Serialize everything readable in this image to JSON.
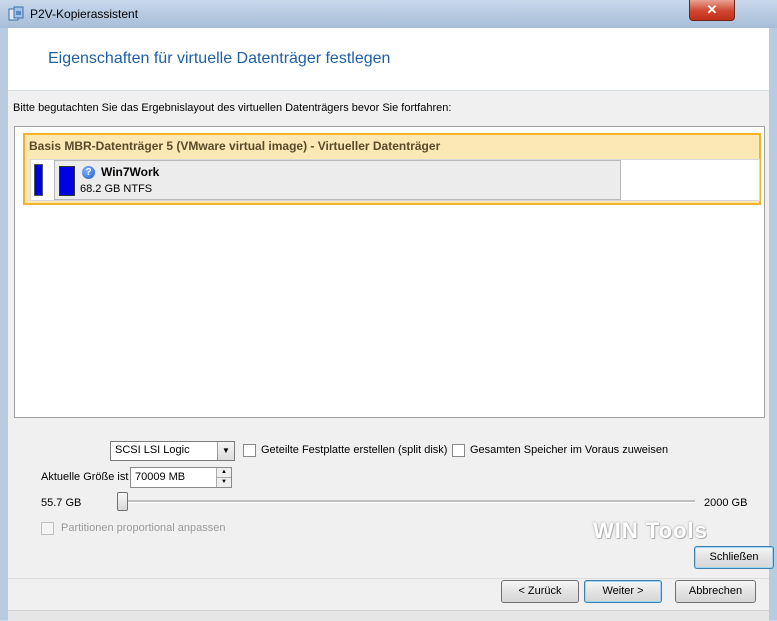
{
  "window": {
    "title": "P2V-Kopierassistent",
    "close_glyph": "✕"
  },
  "header": {
    "title": "Eigenschaften für virtuelle Datenträger festlegen"
  },
  "instruction": "Bitte begutachten Sie das Ergebnislayout des virtuellen Datenträgers bevor Sie fortfahren:",
  "disk": {
    "header": "Basis MBR-Datenträger 5 (VMware virtual image) - Virtueller Datenträger",
    "partition": {
      "name": "Win7Work",
      "size": "68.2 GB NTFS",
      "icon": "help-icon"
    }
  },
  "controls": {
    "controller_select": "SCSI LSI Logic",
    "split_disk_label": "Geteilte Festplatte erstellen (split disk)",
    "split_disk_checked": false,
    "preallocate_label": "Gesamten Speicher im Voraus zuweisen",
    "preallocate_checked": false,
    "current_size_label": "Aktuelle Größe ist",
    "current_size_value": "70009 MB",
    "slider_min_label": "55.7 GB",
    "slider_max_label": "2000 GB",
    "proportional_label": "Partitionen proportional anpassen",
    "proportional_checked": false
  },
  "watermark": "WIN Tools",
  "buttons": {
    "close": "Schließen",
    "back": "< Zurück",
    "next": "Weiter >",
    "cancel": "Abbrechen"
  },
  "colors": {
    "header_title": "#1e5fa6",
    "disk_highlight_bg": "#fbe8b4",
    "disk_highlight_border": "#f0b32a",
    "partition_bar": "#0000e0"
  }
}
